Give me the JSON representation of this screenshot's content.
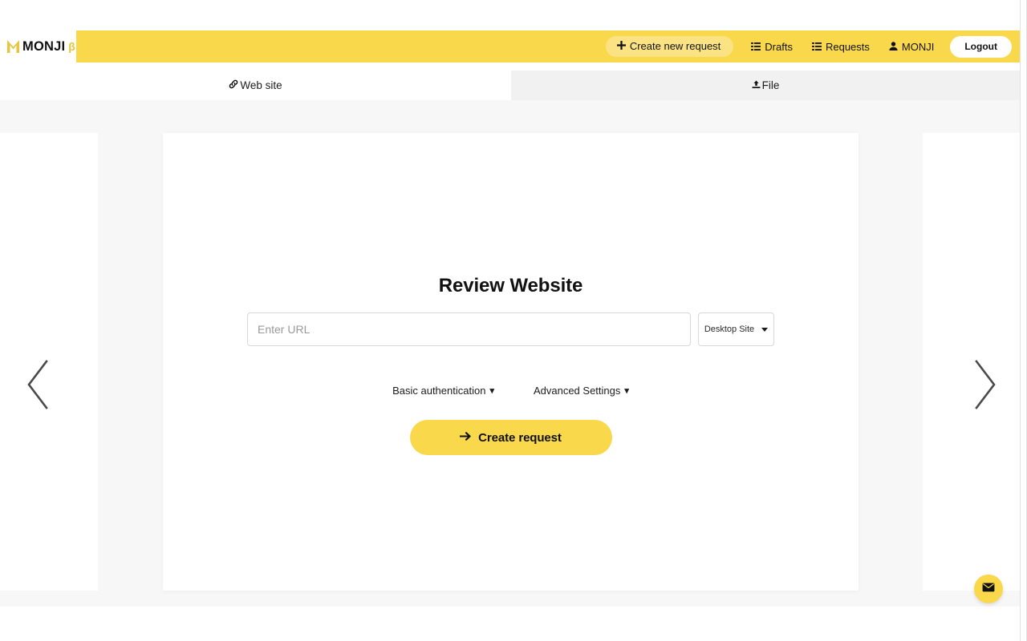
{
  "brand": {
    "name": "MONJI",
    "beta_mark": "β",
    "logo_icon": "monji-m-mark",
    "logo_color": "#e8c53c"
  },
  "navbar": {
    "background_color": "#fad84b",
    "create_request": {
      "label": "Create new request",
      "icon": "plus-icon"
    },
    "drafts": {
      "label": "Drafts",
      "icon": "list-icon"
    },
    "requests": {
      "label": "Requests",
      "icon": "list-icon"
    },
    "user": {
      "label": "MONJI",
      "icon": "user-icon"
    },
    "logout": {
      "label": "Logout"
    }
  },
  "tabs": [
    {
      "label": "Web site",
      "icon": "link-icon",
      "active": true
    },
    {
      "label": "File",
      "icon": "upload-icon",
      "active": false
    }
  ],
  "main": {
    "title": "Review Website",
    "url_field": {
      "placeholder": "Enter URL",
      "value": ""
    },
    "site_mode": {
      "selected": "Desktop Site",
      "icon": "caret-down-icon"
    },
    "toggles": [
      {
        "label": "Basic authentication",
        "icon": "chevron-down-icon"
      },
      {
        "label": "Advanced Settings",
        "icon": "chevron-down-icon"
      }
    ],
    "submit": {
      "label": "Create request",
      "icon": "arrow-right-icon",
      "color": "#fad84b"
    }
  },
  "carousel": {
    "prev": {
      "icon": "chevron-left-icon"
    },
    "next": {
      "icon": "chevron-right-icon"
    }
  },
  "support": {
    "fab": {
      "icon": "envelope-icon",
      "color": "#fad84b"
    }
  }
}
